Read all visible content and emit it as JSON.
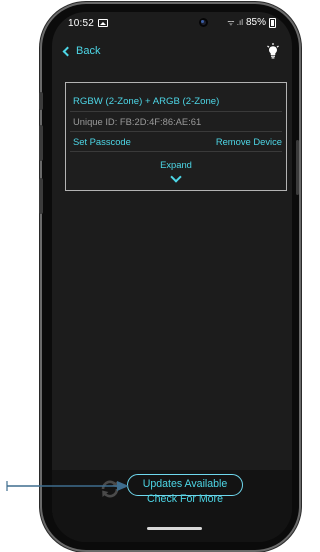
{
  "status_bar": {
    "time": "10:52",
    "signal": "ᯤ .ıl",
    "battery": "85%"
  },
  "nav": {
    "back_label": "Back",
    "bulb_icon": "lightbulb-icon"
  },
  "device_card": {
    "title": "RGBW (2-Zone) + ARGB (2-Zone)",
    "unique_id": "Unique ID: FB:2D:4F:86:AE:61",
    "set_passcode_label": "Set Passcode",
    "remove_device_label": "Remove Device",
    "expand_label": "Expand"
  },
  "update_bar": {
    "updates_label": "Updates Available",
    "check_label": "Check For More",
    "refresh_icon": "refresh-icon"
  },
  "colors": {
    "accent": "#4dd6e6",
    "annotation": "#3e6d8e",
    "screen_bg": "#1c1c1c"
  }
}
